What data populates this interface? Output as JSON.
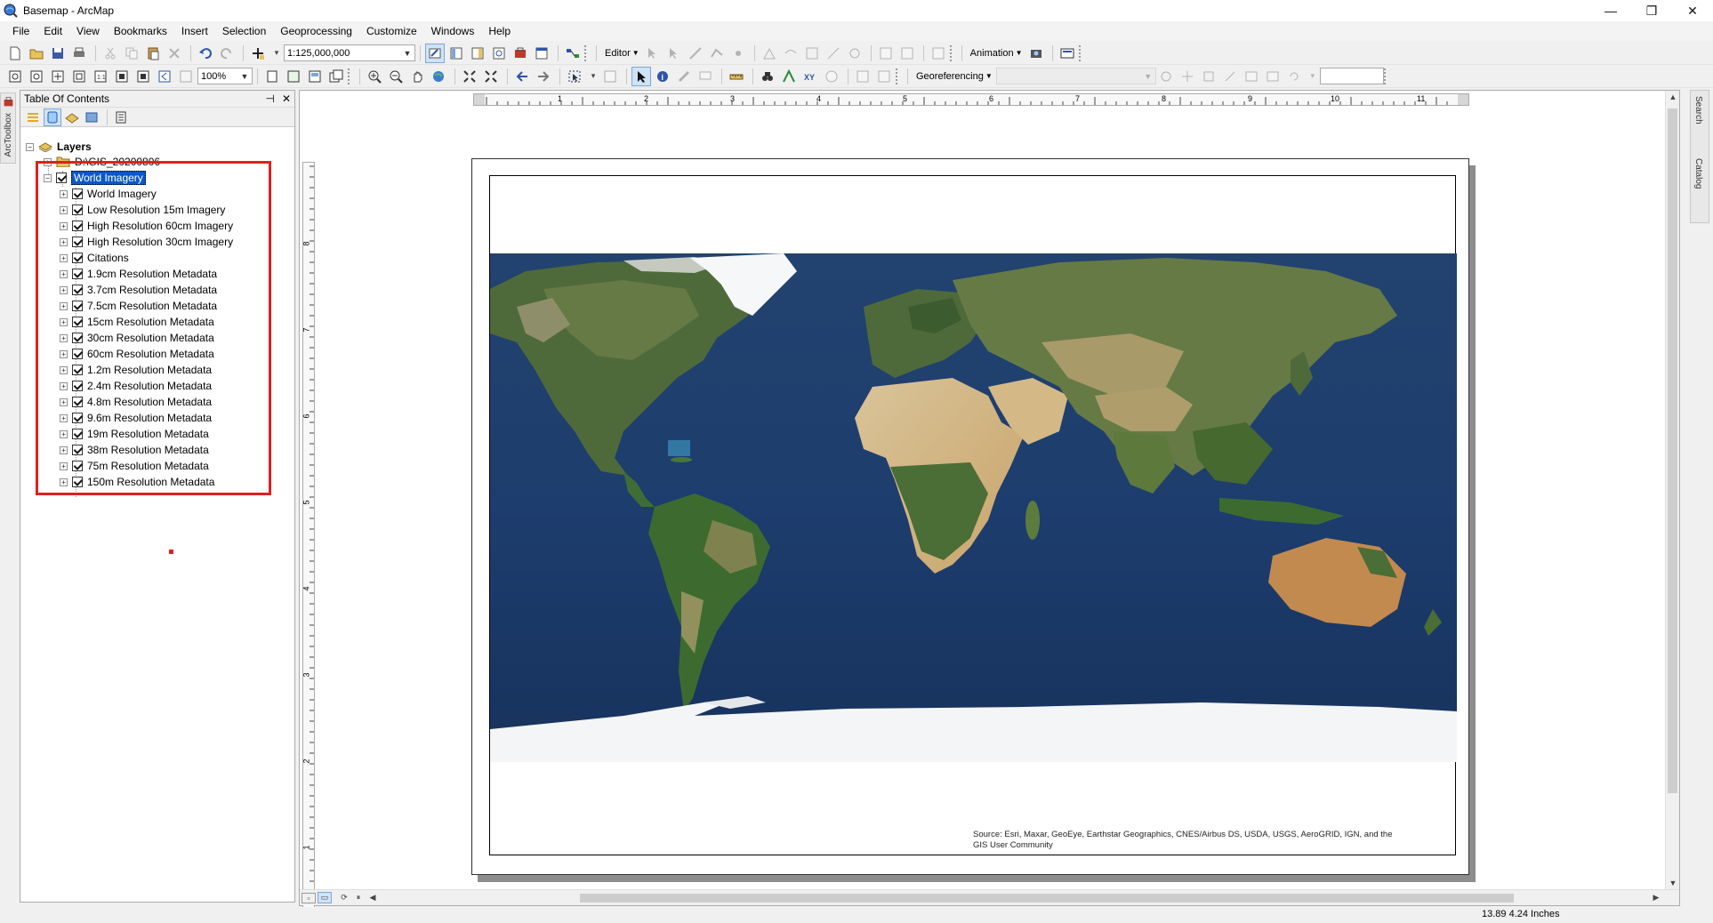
{
  "window": {
    "title": "Basemap - ArcMap",
    "min_glyph": "—",
    "restore_glyph": "❐",
    "close_glyph": "✕"
  },
  "menu": [
    "File",
    "Edit",
    "View",
    "Bookmarks",
    "Insert",
    "Selection",
    "Geoprocessing",
    "Customize",
    "Windows",
    "Help"
  ],
  "toolbar": {
    "scale_value": "1:125,000,000",
    "editor_label": "Editor",
    "animation_label": "Animation",
    "zoom_value": "100%",
    "georeferencing_label": "Georeferencing"
  },
  "left_tab": "ArcToolbox",
  "toc": {
    "title": "Table Of Contents",
    "pin_glyph": "📌",
    "close_glyph": "✕",
    "root": "Layers",
    "folder": "D:\\GIS_20200806",
    "group": "World Imagery",
    "sublayers": [
      "World Imagery",
      "Low Resolution 15m Imagery",
      "High Resolution 60cm Imagery",
      "High Resolution 30cm Imagery",
      "Citations",
      "1.9cm Resolution Metadata",
      "3.7cm Resolution Metadata",
      "7.5cm Resolution Metadata",
      "15cm Resolution Metadata",
      "30cm Resolution Metadata",
      "60cm Resolution Metadata",
      "1.2m Resolution Metadata",
      "2.4m Resolution Metadata",
      "4.8m Resolution Metadata",
      "9.6m Resolution Metadata",
      "19m Resolution Metadata",
      "38m Resolution Metadata",
      "75m Resolution Metadata",
      "150m Resolution Metadata"
    ]
  },
  "ruler": {
    "h_labels": [
      "1",
      "2",
      "3",
      "4",
      "5",
      "6",
      "7",
      "8",
      "9",
      "10",
      "11"
    ],
    "v_labels": [
      "8",
      "7",
      "6",
      "5",
      "4",
      "3",
      "2",
      "1"
    ]
  },
  "layout": {
    "attribution_line1": "Source: Esri, Maxar, GeoEye, Earthstar Geographics, CNES/Airbus DS, USDA, USGS, AeroGRID, IGN, and the",
    "attribution_line2": "GIS User Community"
  },
  "right_tabs": [
    "Search",
    "Catalog"
  ],
  "status": {
    "coordinates": "13.89  4.24 Inches"
  },
  "colors": {
    "selection": "#0a58c9",
    "highlight": "#e01f1f",
    "ocean": "#1d3d6e"
  }
}
